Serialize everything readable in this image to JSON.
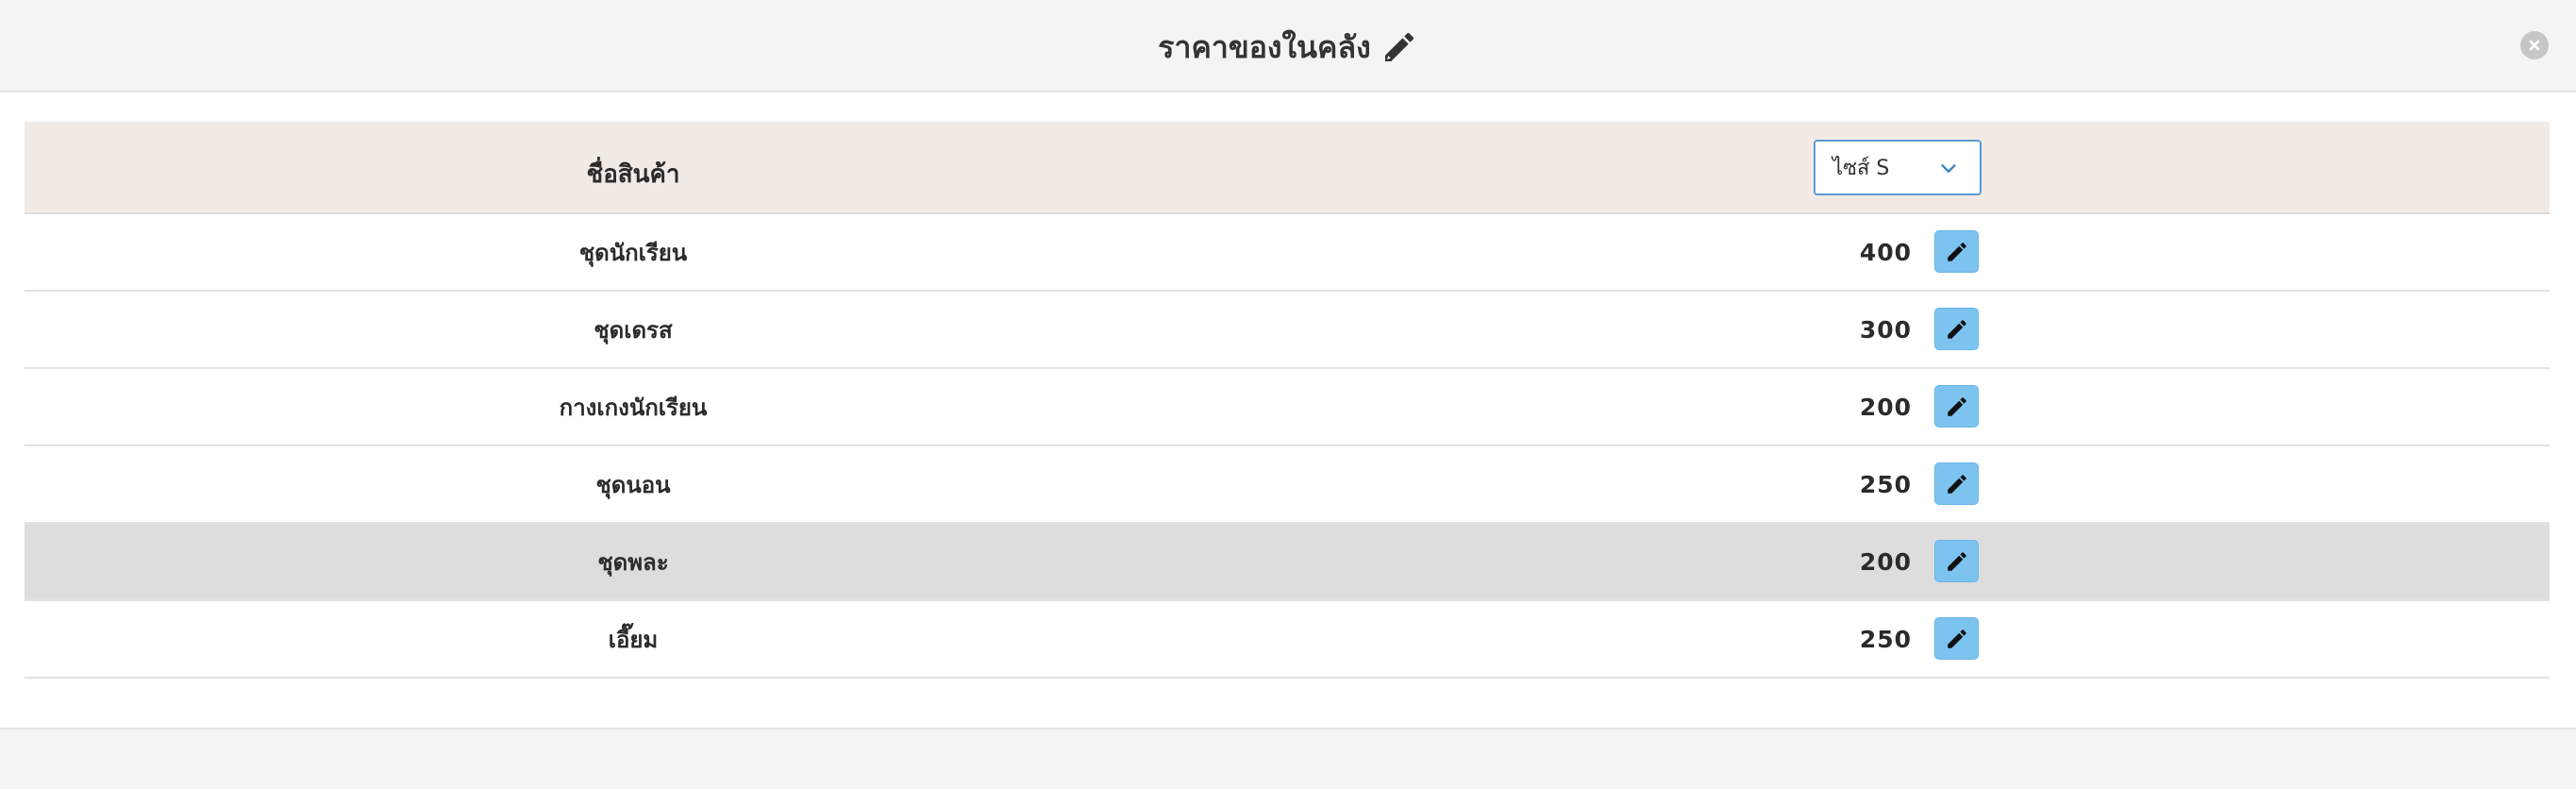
{
  "modal": {
    "title": "ราคาของในคลัง",
    "title_icon": "pencil-icon",
    "close_icon": "close-icon"
  },
  "table": {
    "header": {
      "name_label": "ชื่อสินค้า",
      "size_select": {
        "selected": "ไซส์ S",
        "icon": "chevron-down-icon"
      }
    },
    "rows": [
      {
        "name": "ชุดนักเรียน",
        "price": "400",
        "highlighted": false
      },
      {
        "name": "ชุดเดรส",
        "price": "300",
        "highlighted": false
      },
      {
        "name": "กางเกงนักเรียน",
        "price": "200",
        "highlighted": false
      },
      {
        "name": "ชุดนอน",
        "price": "250",
        "highlighted": false
      },
      {
        "name": "ชุดพละ",
        "price": "200",
        "highlighted": true
      },
      {
        "name": "เอี๊ยม",
        "price": "250",
        "highlighted": false
      }
    ],
    "edit_icon": "pencil-icon"
  },
  "colors": {
    "header_bg": "#f4f4f4",
    "table_header_bg": "#f2ebe5",
    "highlight_row_bg": "#dddddd",
    "edit_button_bg": "#7cc3f0",
    "select_border": "#5b9bd5"
  }
}
